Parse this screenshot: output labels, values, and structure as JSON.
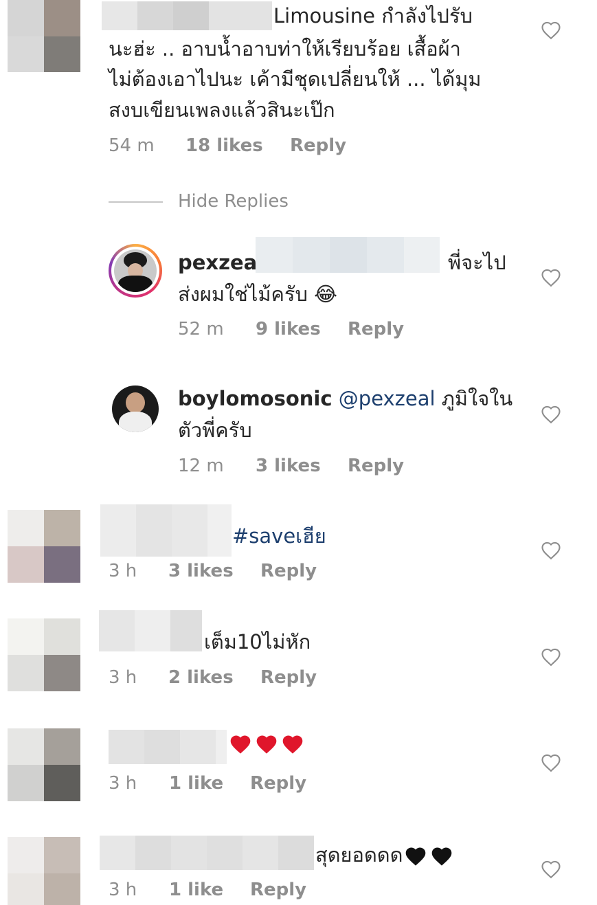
{
  "comments": [
    {
      "text": "Limousine กำลังไปรับ",
      "text_lines": [
        "นะฮ่ะ .. อาบน้ำอาบท่าให้เรียบร้อย เสื้อผ้า",
        "ไม่ต้องเอาไปนะ เค้ามีชุดเปลี่ยนให้ ... ได้มุม",
        "สงบเขียนเพลงแล้วสินะเป๊ก"
      ],
      "time": "54 m",
      "likes": "18 likes",
      "reply": "Reply"
    },
    {
      "text": "#saveเฮีย",
      "time": "3 h",
      "likes": "3 likes",
      "reply": "Reply"
    },
    {
      "text": "เต็ม10ไม่หัก",
      "time": "3 h",
      "likes": "2 likes",
      "reply": "Reply"
    },
    {
      "text": "",
      "time": "3 h",
      "likes": "1 like",
      "reply": "Reply"
    },
    {
      "text": "สุดยอดดด",
      "time": "3 h",
      "likes": "1 like",
      "reply": "Reply"
    }
  ],
  "hide_replies": "Hide Replies",
  "replies": [
    {
      "username": "pexzeal",
      "text": "พี่จะไป",
      "text_line2": "ส่งผมใช่ไม้ครับ 😂",
      "time": "52 m",
      "likes": "9 likes",
      "reply": "Reply"
    },
    {
      "username": "boylomosonic",
      "mention": "@pexzeal",
      "text": "ภูมิใจใน",
      "text_line2": "ตัวพี่ครับ",
      "time": "12 m",
      "likes": "3 likes",
      "reply": "Reply"
    }
  ],
  "colors": {
    "text": "#262626",
    "meta": "#8e8e8e",
    "mention": "#1d3f6e",
    "red_heart": "#e0162b",
    "black_heart": "#111111"
  }
}
